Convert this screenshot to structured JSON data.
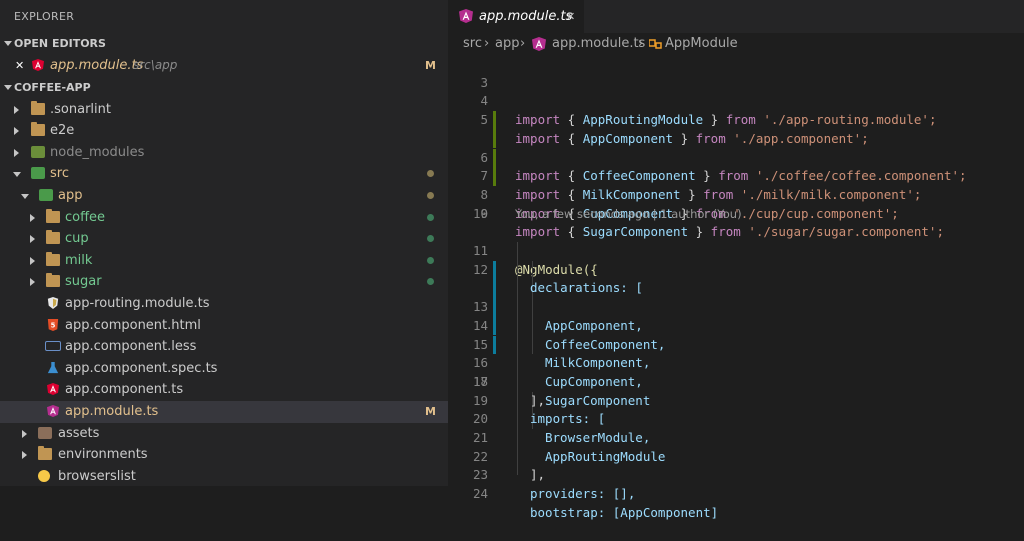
{
  "explorer": {
    "title": "EXPLORER"
  },
  "open_editors": {
    "title": "OPEN EDITORS",
    "file": "app.module.ts",
    "path": "src\\app",
    "status": "M",
    "close_glyph": "✕"
  },
  "project": {
    "title": "COFFEE-APP",
    "items": [
      {
        "label": ".sonarlint"
      },
      {
        "label": "e2e"
      },
      {
        "label": "node_modules"
      },
      {
        "label": "src"
      },
      {
        "label": "app"
      },
      {
        "label": "coffee"
      },
      {
        "label": "cup"
      },
      {
        "label": "milk"
      },
      {
        "label": "sugar"
      },
      {
        "label": "app-routing.module.ts"
      },
      {
        "label": "app.component.html"
      },
      {
        "label": "app.component.less"
      },
      {
        "label": "app.component.spec.ts"
      },
      {
        "label": "app.component.ts"
      },
      {
        "label": "app.module.ts",
        "status": "M"
      },
      {
        "label": "assets"
      },
      {
        "label": "environments"
      },
      {
        "label": "browserslist"
      }
    ]
  },
  "tab": {
    "label": "app.module.ts",
    "close_glyph": "✕"
  },
  "breadcrumb": {
    "p1": "src",
    "p2": "app",
    "p3": "app.module.ts",
    "p4": "AppModule",
    "sep": "›"
  },
  "codelens": "You, a few seconds ago | 1 author (You)",
  "code": {
    "kw_import": "import",
    "kw_from": "from",
    "lines": [
      {
        "n": "3"
      },
      {
        "n": "4",
        "name": "AppRoutingModule",
        "path": "'./app-routing.module';"
      },
      {
        "n": "5",
        "name": "AppComponent",
        "path": "'./app.component';"
      },
      {
        "n": "6",
        "name": "CoffeeComponent",
        "path": "'./coffee/coffee.component';"
      },
      {
        "n": "7",
        "name": "MilkComponent",
        "path": "'./milk/milk.component';"
      },
      {
        "n": "8",
        "name": "CupComponent",
        "path": "'./cup/cup.component';"
      },
      {
        "n": "9",
        "name": "SugarComponent",
        "path": "'./sugar/sugar.component';"
      },
      {
        "n": "10"
      },
      {
        "n": "11",
        "text": "@NgModule({"
      },
      {
        "n": "12",
        "text": "declarations: ["
      },
      {
        "n": "13",
        "text": "AppComponent,"
      },
      {
        "n": "14",
        "text": "CoffeeComponent,"
      },
      {
        "n": "15",
        "text": "MilkComponent,"
      },
      {
        "n": "16",
        "text": "CupComponent,"
      },
      {
        "n": "17",
        "text": "SugarComponent"
      },
      {
        "n": "18",
        "text": "],"
      },
      {
        "n": "19",
        "text": "imports: ["
      },
      {
        "n": "20",
        "text": "BrowserModule,"
      },
      {
        "n": "21",
        "text": "AppRoutingModule"
      },
      {
        "n": "22",
        "text": "],"
      },
      {
        "n": "23",
        "text": "providers: [],"
      },
      {
        "n": "24",
        "text": "bootstrap: [AppComponent]"
      }
    ]
  },
  "colors": {
    "added_gutter": "#587c0c",
    "modified_gutter": "#0c7d9d",
    "angular_icon": "#dd0031",
    "selected_row": "#37373d"
  }
}
